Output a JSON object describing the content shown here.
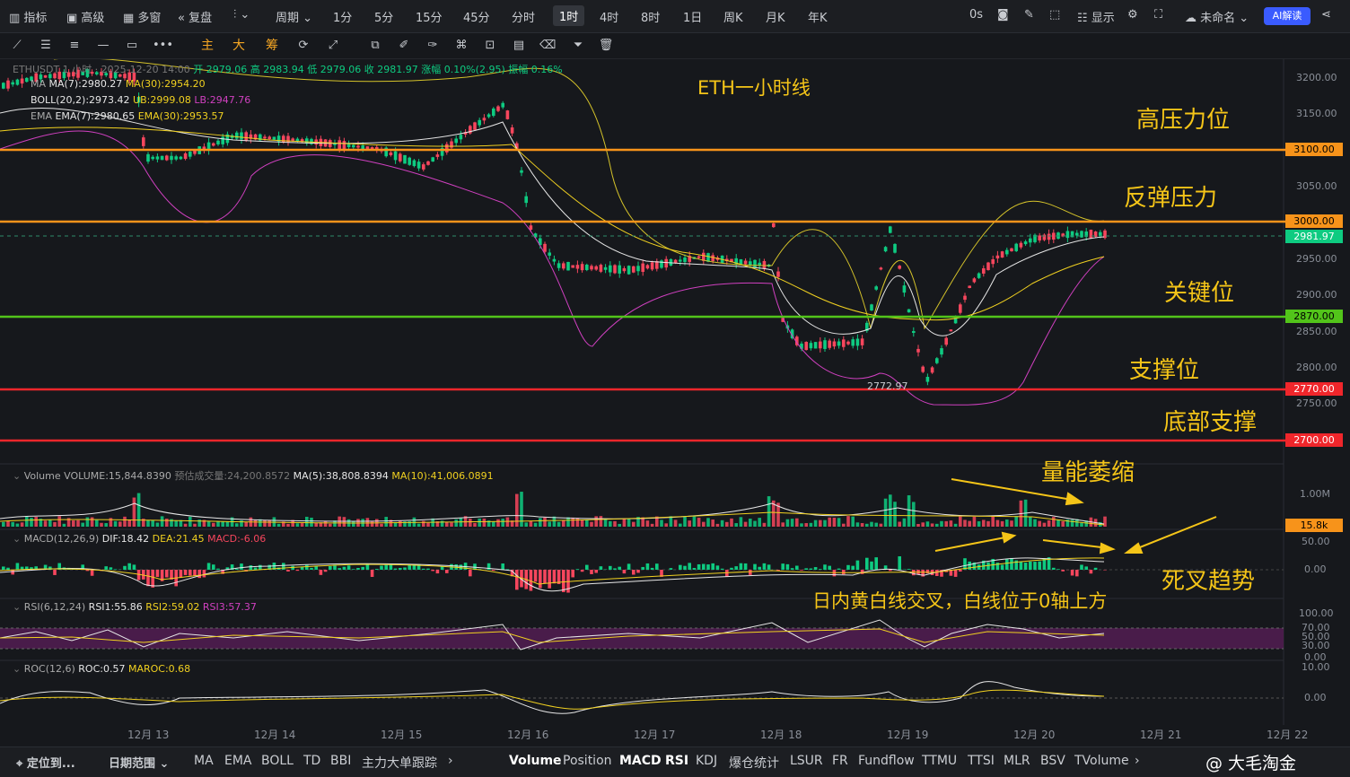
{
  "topbar": {
    "indicators": "指标",
    "advanced": "高级",
    "multi_window": "多窗",
    "replay": "复盘",
    "period": "周期",
    "timeframes": [
      "1分",
      "5分",
      "15分",
      "45分",
      "分时",
      "1时",
      "4时",
      "8时",
      "1日",
      "周K",
      "月K",
      "年K"
    ],
    "active_timeframe": "1时",
    "zero_s": "0s",
    "display": "显示",
    "unnamed": "未命名",
    "ai": "AI解读"
  },
  "toolbar2": {
    "main": "主",
    "big": "大",
    "chips": "筹"
  },
  "legend": {
    "symbol_line": "ETHUSDT 1 小时 · 2025-12-20 14:00",
    "open": "开 2979.06",
    "high": "高 2983.94",
    "low": "低 2979.06",
    "close": "收 2981.97",
    "change": "涨幅 0.10%(2.95)",
    "amplitude": "振幅 0.16%",
    "ma_prefix": "MA",
    "ma7": "MA(7):2980.27",
    "ma30": "MA(30):2954.20",
    "boll_mid": "BOLL(20,2):2973.42",
    "boll_ub": "UB:2999.08",
    "boll_lb": "LB:2947.76",
    "ema_prefix": "EMA",
    "ema7": "EMA(7):2980.65",
    "ema30": "EMA(30):2953.57"
  },
  "volume_legend": {
    "label": "Volume",
    "volume": "VOLUME:15,844.8390",
    "forecast": "预估成交量:24,200.8572",
    "ma5": "MA(5):38,808.8394",
    "ma10": "MA(10):41,006.0891"
  },
  "macd_legend": {
    "label": "MACD(12,26,9)",
    "dif": "DIF:18.42",
    "dea": "DEA:21.45",
    "macd": "MACD:-6.06"
  },
  "rsi_legend": {
    "label": "RSI(6,12,24)",
    "rsi1": "RSI1:55.86",
    "rsi2": "RSI2:59.02",
    "rsi3": "RSI3:57.37"
  },
  "roc_legend": {
    "label": "ROC(12,6)",
    "roc": "ROC:0.57",
    "maroc": "MAROC:0.68"
  },
  "annotations": {
    "title": "ETH一小时线",
    "high_pressure": "高压力位",
    "rebound_pressure": "反弹压力",
    "key_level": "关键位",
    "support": "支撑位",
    "bottom_support": "底部支撑",
    "volume_shrink": "量能萎缩",
    "death_cross": "死叉趋势",
    "macd_note": "日内黄白线交叉，白线位于0轴上方",
    "low_mark": "2772.97"
  },
  "price_axis": [
    "3200.00",
    "3150.00",
    "3050.00",
    "2950.00",
    "2900.00",
    "2850.00",
    "2800.00",
    "2750.00"
  ],
  "price_tags": {
    "p3100": "3100.00",
    "p3000": "3000.00",
    "p2981": "2981.97",
    "p2870": "2870.00",
    "p2770": "2770.00",
    "p2700": "2700.00"
  },
  "volume_axis": {
    "mid": "1.00M",
    "tag": "15.8k"
  },
  "macd_axis": [
    "50.00",
    "0.00"
  ],
  "rsi_axis": [
    "100.00",
    "70.00",
    "50.00",
    "30.00",
    "0.00"
  ],
  "roc_axis": [
    "10.00",
    "0.00"
  ],
  "date_axis": [
    "12月 13",
    "12月 14",
    "12月 15",
    "12月 16",
    "12月 17",
    "12月 18",
    "12月 19",
    "12月 20",
    "12月 21",
    "12月 22"
  ],
  "colors": {
    "orange_line": "#f7931a",
    "green_line": "#52c41a",
    "red_line": "#f0262b",
    "annot": "#f5c518",
    "up": "#0ecb81",
    "down": "#f6465d"
  },
  "bottombar": {
    "locate": "定位到...",
    "date_range": "日期范围",
    "indicators_left": [
      "MA",
      "EMA",
      "BOLL",
      "TD",
      "BBI",
      "主力大单跟踪"
    ],
    "indicators_right": [
      "Volume",
      "Position",
      "MACD",
      "RSI",
      "KDJ",
      "爆仓统计",
      "LSUR",
      "FR",
      "Fundflow",
      "TTMU",
      "TTSI",
      "MLR",
      "BSV",
      "TVolume"
    ],
    "watermark": "@ 大毛淘金"
  }
}
